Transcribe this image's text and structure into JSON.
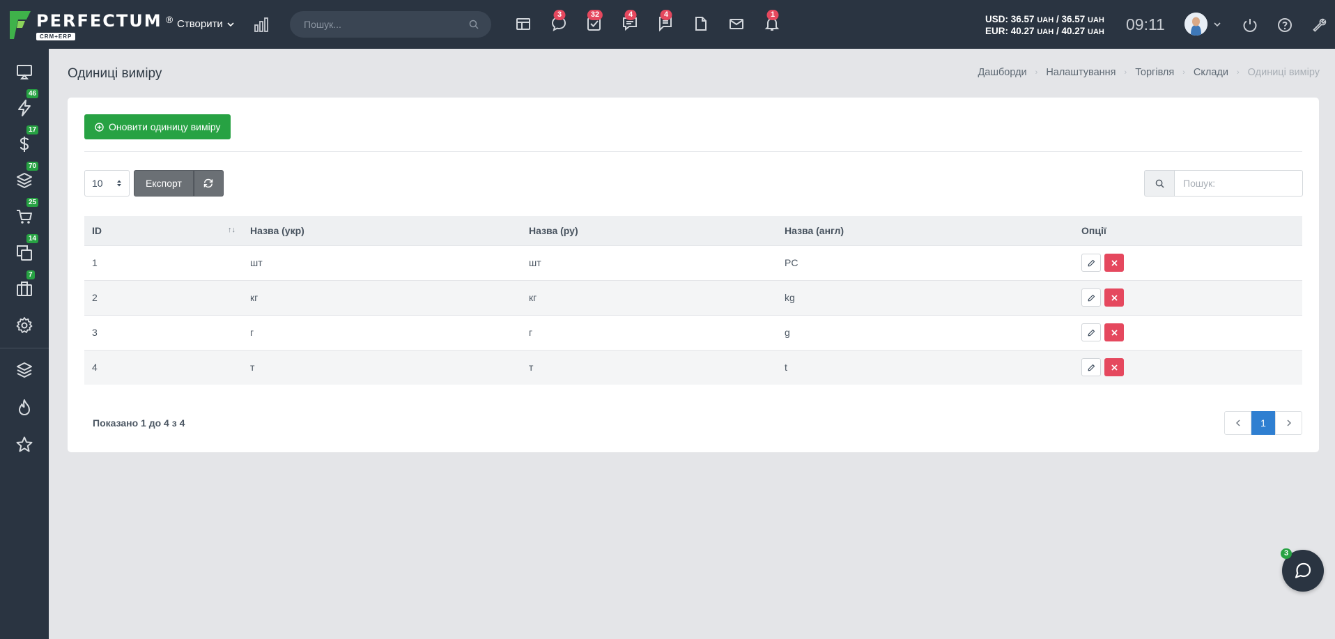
{
  "brand": {
    "name": "PERFECTUM",
    "registered": "®",
    "sub": "CRM+ERP"
  },
  "header": {
    "create_label": "Створити",
    "search_placeholder": "Пошук...",
    "badges": {
      "chat": "3",
      "tasks": "32",
      "comments": "4",
      "messages": "4",
      "notifications": "1"
    },
    "rates": {
      "usd_label": "USD:",
      "usd_buy": "36.57",
      "usd_sell": "36.57",
      "eur_label": "EUR:",
      "eur_buy": "40.27",
      "eur_sell": "40.27",
      "currency": "UAH",
      "sep": "/"
    },
    "time": "09:11"
  },
  "sidebar": {
    "badges": [
      "46",
      "17",
      "70",
      "25",
      "14",
      "7"
    ]
  },
  "page": {
    "title": "Одиниці виміру",
    "breadcrumb": [
      "Дашборди",
      "Налаштування",
      "Торгівля",
      "Склади",
      "Одиниці виміру"
    ]
  },
  "toolbar": {
    "update_label": "Оновити одиницу виміру",
    "page_length": "10",
    "export_label": "Експорт",
    "search_placeholder": "Пошук:"
  },
  "table": {
    "columns": [
      "ID",
      "Назва (укр)",
      "Назва (ру)",
      "Назва (англ)",
      "Опції"
    ],
    "rows": [
      {
        "id": "1",
        "ukr": "шт",
        "ru": "шт",
        "eng": "PC"
      },
      {
        "id": "2",
        "ukr": "кг",
        "ru": "кг",
        "eng": "kg"
      },
      {
        "id": "3",
        "ukr": "г",
        "ru": "г",
        "eng": "g"
      },
      {
        "id": "4",
        "ukr": "т",
        "ru": "т",
        "eng": "t"
      }
    ],
    "info": "Показано 1 до 4 з 4",
    "current_page": "1"
  },
  "chat": {
    "badge": "3"
  },
  "colors": {
    "dark": "#2a3441",
    "green": "#27a243",
    "red": "#e5485e",
    "blue": "#2f7fd1"
  }
}
